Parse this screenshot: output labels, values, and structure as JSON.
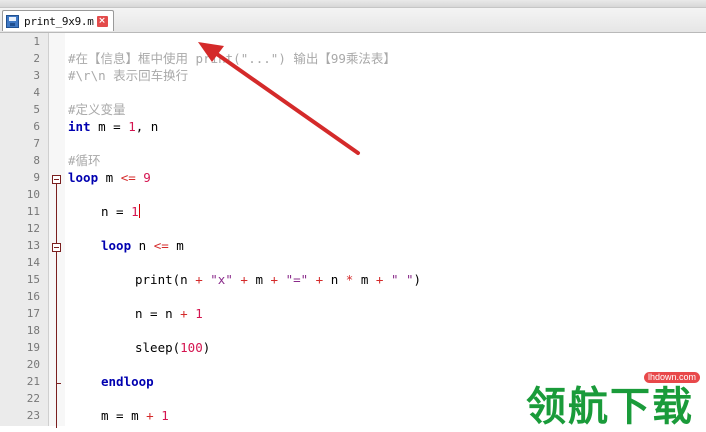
{
  "tab": {
    "file_name": "print_9x9.m",
    "close_glyph": "×"
  },
  "lines": [
    {
      "n": "1",
      "code": ""
    },
    {
      "n": "2",
      "code": "#在【信息】框中使用 print(\"...\") 输出【99乘法表】"
    },
    {
      "n": "3",
      "code": "#\\r\\n 表示回车换行"
    },
    {
      "n": "4",
      "code": ""
    },
    {
      "n": "5",
      "code": "#定义变量"
    },
    {
      "n": "6",
      "code": "int m = 1, n"
    },
    {
      "n": "7",
      "code": ""
    },
    {
      "n": "8",
      "code": "#循环"
    },
    {
      "n": "9",
      "code": "loop m <= 9"
    },
    {
      "n": "10",
      "code": ""
    },
    {
      "n": "11",
      "code": "n = 1"
    },
    {
      "n": "12",
      "code": ""
    },
    {
      "n": "13",
      "code": "loop n <= m"
    },
    {
      "n": "14",
      "code": ""
    },
    {
      "n": "15",
      "code": "print(n + \"x\" + m + \"=\" + n * m + \" \")"
    },
    {
      "n": "16",
      "code": ""
    },
    {
      "n": "17",
      "code": "n = n + 1"
    },
    {
      "n": "18",
      "code": ""
    },
    {
      "n": "19",
      "code": "sleep(100)"
    },
    {
      "n": "20",
      "code": ""
    },
    {
      "n": "21",
      "code": "endloop"
    },
    {
      "n": "22",
      "code": ""
    },
    {
      "n": "23",
      "code": "m = m + 1"
    }
  ],
  "tokens": {
    "c2": "#在【信息】框中使用 print(\"...\") 输出【99乘法表】",
    "c3": "#\\r\\n 表示回车换行",
    "c5": "#定义变量",
    "c8": "#循环",
    "int": "int",
    "l6_rest": " m = ",
    "one": "1",
    "l6_tail": ", n",
    "loop": "loop",
    "l9_mid": " m ",
    "le": "<=",
    "nine": "9",
    "n_eq": "n = ",
    "l13_mid": " n ",
    "l13_m": " m",
    "print": "print(n ",
    "plus": "+",
    "sx": "\"x\"",
    "m_sp": " m ",
    "seq": "\"=\"",
    "n_sp": " n ",
    "mul": "*",
    "ssp": "\" \"",
    "close_paren": ")",
    "sp": " ",
    "n_eq_n": "n = n ",
    "sleep": "sleep(",
    "hundred": "100",
    "endloop": "endloop",
    "m_eq_m": "m = m "
  },
  "watermark": {
    "text": "领航下载",
    "url": "lhdown.com"
  },
  "colors": {
    "comment": "#a9a9a9",
    "keyword": "#0000b0",
    "number": "#d4144f",
    "string": "#8a2a8a",
    "arrow": "#d42a2a",
    "watermark": "#1a9b3a"
  }
}
